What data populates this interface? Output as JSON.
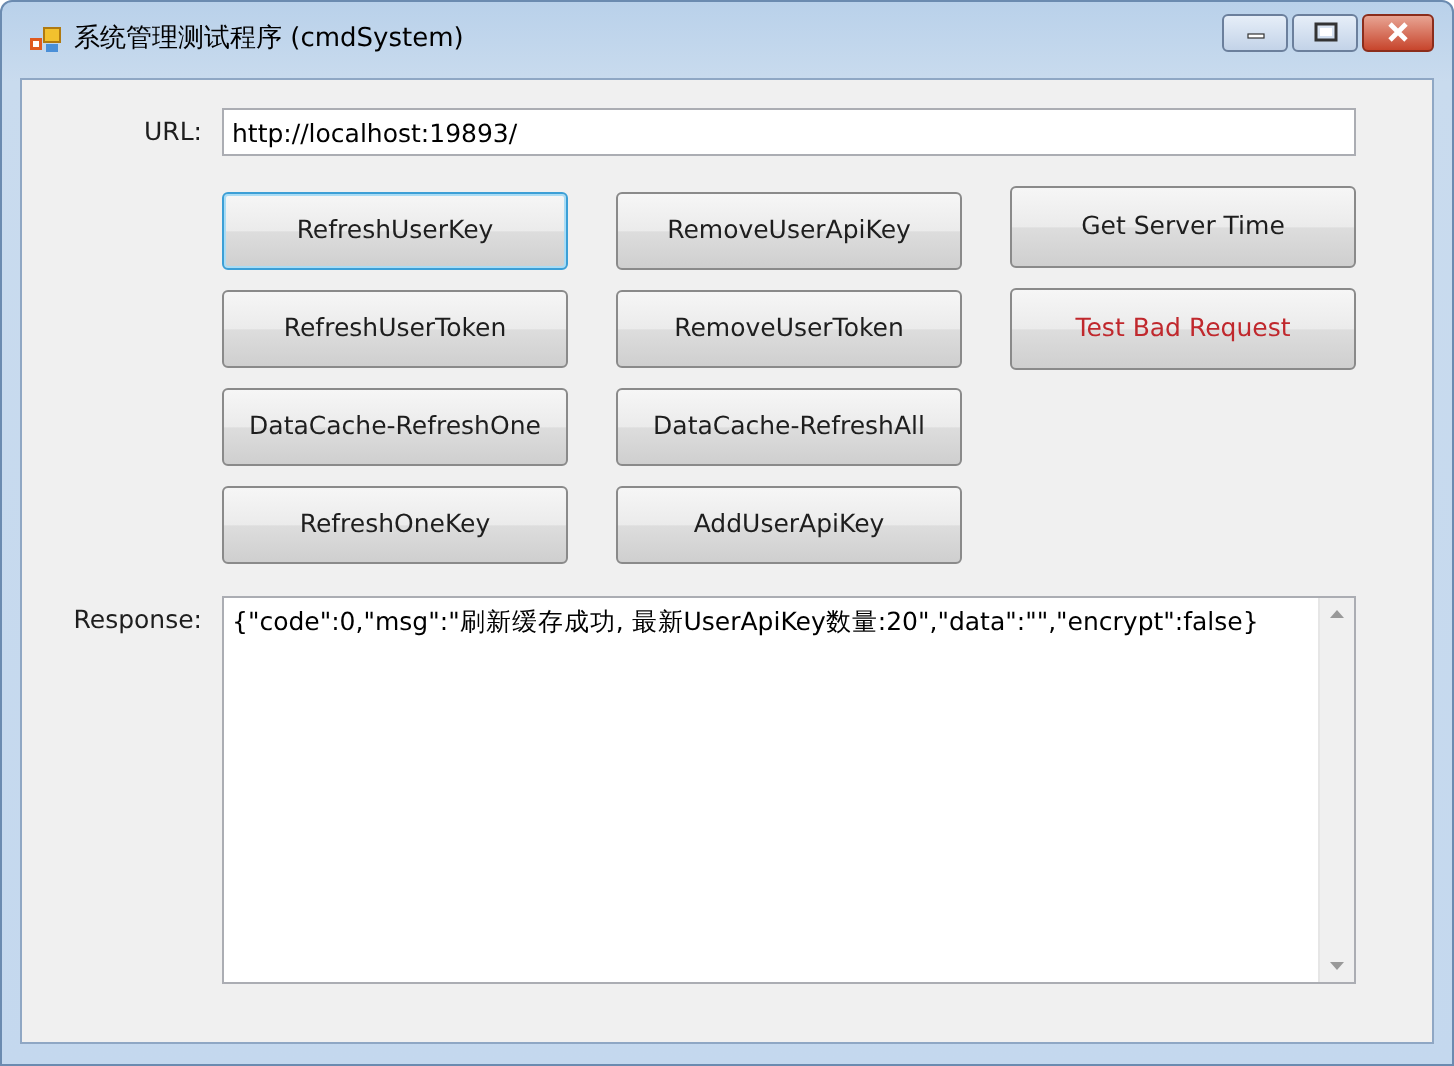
{
  "window": {
    "title": "系统管理测试程序 (cmdSystem)"
  },
  "url": {
    "label": "URL:",
    "value": "http://localhost:19893/"
  },
  "button_columns": [
    [
      {
        "label": "RefreshUserKey",
        "focused": true,
        "color": "#1e1e1e"
      },
      {
        "label": "RefreshUserToken",
        "focused": false,
        "color": "#1e1e1e"
      },
      {
        "label": "DataCache-RefreshOne",
        "focused": false,
        "color": "#1e1e1e"
      },
      {
        "label": "RefreshOneKey",
        "focused": false,
        "color": "#1e1e1e"
      }
    ],
    [
      {
        "label": "RemoveUserApiKey",
        "focused": false,
        "color": "#1e1e1e"
      },
      {
        "label": "RemoveUserToken",
        "focused": false,
        "color": "#1e1e1e"
      },
      {
        "label": "DataCache-RefreshAll",
        "focused": false,
        "color": "#1e1e1e"
      },
      {
        "label": "AddUserApiKey",
        "focused": false,
        "color": "#1e1e1e"
      }
    ],
    [
      {
        "label": "Get Server Time",
        "focused": false,
        "color": "#1e1e1e"
      },
      {
        "label": "Test Bad Request",
        "focused": false,
        "color": "#c0282d"
      }
    ]
  ],
  "response": {
    "label": "Response:",
    "value": "{\"code\":0,\"msg\":\"刷新缓存成功, 最新UserApiKey数量:20\",\"data\":\"\",\"encrypt\":false}"
  }
}
